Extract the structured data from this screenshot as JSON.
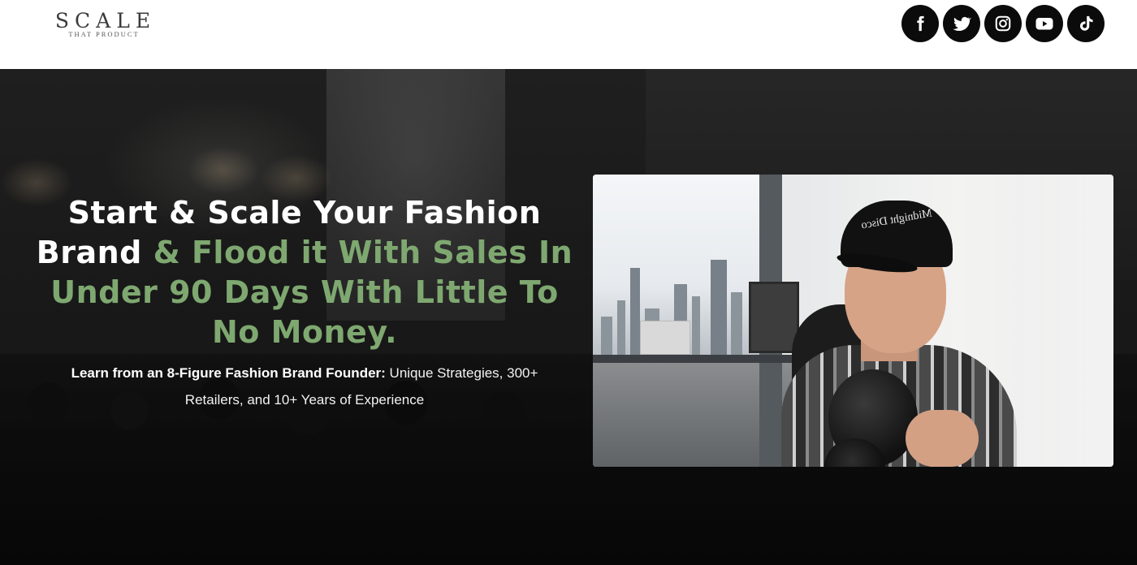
{
  "header": {
    "logo": {
      "main": "SCALE",
      "sub": "THAT PRODUCT"
    },
    "socials": [
      {
        "name": "facebook",
        "icon": "facebook-icon"
      },
      {
        "name": "twitter",
        "icon": "twitter-icon"
      },
      {
        "name": "instagram",
        "icon": "instagram-icon"
      },
      {
        "name": "youtube",
        "icon": "youtube-icon"
      },
      {
        "name": "tiktok",
        "icon": "tiktok-icon"
      }
    ]
  },
  "hero": {
    "headline": {
      "white_1": "Start & Scale Your Fashion Brand",
      "green_1": " & Flood it With Sales In Under 90 Days With Little To No Money."
    },
    "subtitle": {
      "bold": "Learn from an 8-Figure Fashion Brand Founder:",
      "normal": " Unique Strategies, 300+ Retailers, and 10+ Years of Experience"
    },
    "video": {
      "cap_text": "Midnight Disco"
    }
  },
  "colors": {
    "accent_green": "#7ea870",
    "icon_bg": "#0b0b0b",
    "hero_bg": "#1a1a1a"
  }
}
